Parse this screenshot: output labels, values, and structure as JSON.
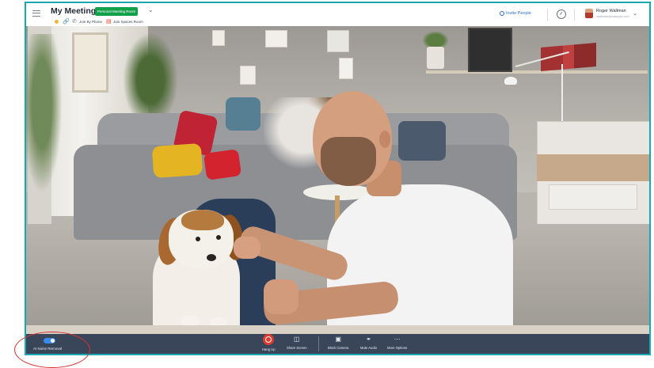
{
  "header": {
    "room_title": "My Meeting Room",
    "room_badge": "Personal Meeting Room",
    "sub_items": [
      {
        "label": "Join By Phone",
        "icon": "phone-icon"
      },
      {
        "label": "Join Spaces Room",
        "icon": "spaces-room-icon"
      }
    ],
    "invite_label": "Invite People",
    "user_name": "Roger Wallman",
    "user_email": "rwallman@example.com"
  },
  "controls": {
    "noise_removal_label": "AI Noise Removal",
    "noise_removal_on": true,
    "hang_up": "Hang Up",
    "share_screen": "Share Screen",
    "block_camera": "Block Camera",
    "mute_audio": "Mute Audio",
    "more_options": "More Options"
  },
  "colors": {
    "frame_border": "#17a8b0",
    "controls_bg": "#39465a",
    "hangup_red": "#e03a2f",
    "toggle_blue": "#3a8bf0",
    "badge_green": "#12a04b",
    "annotation_red": "#d8312e"
  }
}
